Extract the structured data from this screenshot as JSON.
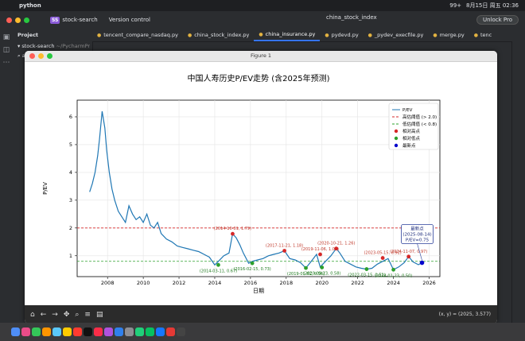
{
  "menubar": {
    "app": "python",
    "right_items": [
      "99+",
      "8月15日 周五 02:36"
    ]
  },
  "toolbar": {
    "project_badge": "SS",
    "project_name": "stock-search",
    "version_control": "Version control",
    "run_config": "china_stock_index",
    "unlock": "Unlock Pro"
  },
  "tabs": [
    {
      "label": "tencent_compare_nasdaq.py"
    },
    {
      "label": "china_stock_index.py"
    },
    {
      "label": "china_insurance.py"
    },
    {
      "label": "pydevd.py"
    },
    {
      "label": "_pydev_execfile.py"
    },
    {
      "label": "merge.py"
    },
    {
      "label": "tenc"
    }
  ],
  "project_panel": {
    "header": "Project",
    "root": "stock-search",
    "root_hint": "~/PycharmPr",
    "search_value": "adi"
  },
  "figure": {
    "window_title": "Figure 1",
    "coords": "(x, y) = (2025, 3.577)"
  },
  "chart_data": {
    "type": "line",
    "title": "中国人寿历史P/EV走势 (含2025年预测)",
    "xlabel": "日期",
    "ylabel": "P/EV",
    "xlim": [
      2006.3,
      2026.6
    ],
    "ylim": [
      0.25,
      6.6
    ],
    "xticks": [
      "2008",
      "2010",
      "2012",
      "2014",
      "2016",
      "2018",
      "2020",
      "2022",
      "2024",
      "2026"
    ],
    "yticks": [
      "1",
      "2",
      "3",
      "4",
      "5",
      "6"
    ],
    "grid": true,
    "legend_position": "top-right",
    "legend": [
      "P/EV",
      "高估阈值 (> 2.0)",
      "低估阈值 (< 0.8)",
      "相对高点",
      "相对低点",
      "最新点"
    ],
    "high_threshold": 2.0,
    "low_threshold": 0.8,
    "series": [
      {
        "name": "P/EV",
        "color": "#1f77b4",
        "x": [
          2007.0,
          2007.15,
          2007.3,
          2007.45,
          2007.55,
          2007.7,
          2007.85,
          2007.95,
          2008.1,
          2008.25,
          2008.4,
          2008.6,
          2008.8,
          2009.0,
          2009.2,
          2009.4,
          2009.6,
          2009.8,
          2010.0,
          2010.2,
          2010.4,
          2010.6,
          2010.8,
          2011.0,
          2011.3,
          2011.6,
          2011.9,
          2012.2,
          2012.5,
          2012.8,
          2013.1,
          2013.4,
          2013.7,
          2014.0,
          2014.2,
          2014.5,
          2014.8,
          2015.0,
          2015.2,
          2015.4,
          2015.6,
          2015.9,
          2016.1,
          2016.4,
          2016.7,
          2017.0,
          2017.3,
          2017.6,
          2017.9,
          2018.2,
          2018.5,
          2018.8,
          2019.1,
          2019.4,
          2019.7,
          2019.9,
          2020.2,
          2020.5,
          2020.8,
          2021.0,
          2021.3,
          2021.6,
          2021.9,
          2022.2,
          2022.5,
          2022.8,
          2023.1,
          2023.4,
          2023.7,
          2024.0,
          2024.3,
          2024.6,
          2024.85,
          2025.1,
          2025.4,
          2025.6
        ],
        "values": [
          3.3,
          3.6,
          4.0,
          4.6,
          5.2,
          6.2,
          5.6,
          4.8,
          4.0,
          3.4,
          3.0,
          2.6,
          2.4,
          2.2,
          2.8,
          2.5,
          2.3,
          2.4,
          2.2,
          2.5,
          2.1,
          2.0,
          2.2,
          1.8,
          1.6,
          1.5,
          1.35,
          1.3,
          1.25,
          1.2,
          1.15,
          1.05,
          0.95,
          0.67,
          0.8,
          1.0,
          1.1,
          1.79,
          1.65,
          1.4,
          1.1,
          0.73,
          0.8,
          0.85,
          0.9,
          1.0,
          1.05,
          1.1,
          1.18,
          0.9,
          0.85,
          0.75,
          0.56,
          0.8,
          1.05,
          0.6,
          0.8,
          1.0,
          1.26,
          1.1,
          0.8,
          0.7,
          0.6,
          0.55,
          0.52,
          0.55,
          0.7,
          0.8,
          0.9,
          0.5,
          0.6,
          0.75,
          0.97,
          0.78,
          0.68,
          0.75
        ]
      }
    ],
    "relative_highs": [
      {
        "x": 2015.0,
        "y": 1.79,
        "label": "(2014-10-31, 1.79)"
      },
      {
        "x": 2017.9,
        "y": 1.18,
        "label": "(2017-11-21, 1.18)"
      },
      {
        "x": 2019.9,
        "y": 1.05,
        "label": "(2019-11-06, 1.05)"
      },
      {
        "x": 2020.8,
        "y": 1.26,
        "label": "(2020-10-21, 1.26)"
      },
      {
        "x": 2023.4,
        "y": 0.92,
        "label": "(2023-05-15, 0.92)"
      },
      {
        "x": 2024.85,
        "y": 0.97,
        "label": "(2024-11-07, 0.97)"
      }
    ],
    "relative_lows": [
      {
        "x": 2014.2,
        "y": 0.67,
        "label": "(2014-03-11, 0.67)"
      },
      {
        "x": 2016.1,
        "y": 0.73,
        "label": "(2016-02-15, 0.73)"
      },
      {
        "x": 2019.1,
        "y": 0.56,
        "label": "(2019-01-02, 0.56)"
      },
      {
        "x": 2020.0,
        "y": 0.58,
        "label": "(2020-03-23, 0.58)"
      },
      {
        "x": 2022.5,
        "y": 0.52,
        "label": "(2022-03-15, 0.52)"
      },
      {
        "x": 2024.0,
        "y": 0.5,
        "label": "(2024-01-23, 0.50)"
      }
    ],
    "latest": {
      "x": 2025.6,
      "y": 0.75,
      "box_lines": [
        "最新点",
        "(2025-08-14)",
        "P/EV=0.75"
      ]
    }
  }
}
